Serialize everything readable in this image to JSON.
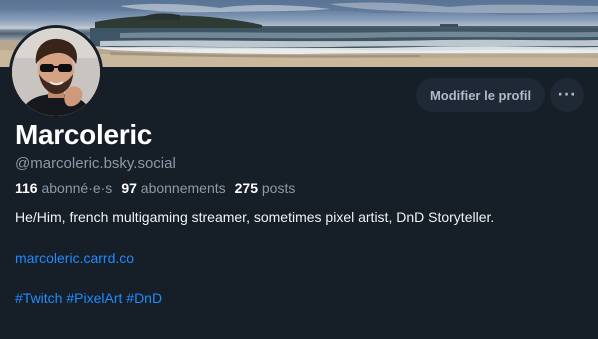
{
  "profile": {
    "display_name": "Marcoleric",
    "handle": "@marcoleric.bsky.social",
    "bio": "He/Him, french multigaming streamer, sometimes pixel artist, DnD Storyteller.",
    "link": "marcoleric.carrd.co",
    "hashtags": [
      "#Twitch",
      "#PixelArt",
      "#DnD"
    ]
  },
  "stats": {
    "followers_count": "116",
    "followers_label": "abonné·e·s",
    "following_count": "97",
    "following_label": "abonnements",
    "posts_count": "275",
    "posts_label": "posts"
  },
  "actions": {
    "edit_profile_label": "Modifier le profil",
    "more_icon": "more-horizontal-icon"
  },
  "colors": {
    "background": "#161e27",
    "button_bg": "#1e2935",
    "link": "#208bfe",
    "muted_text": "#8c99a8"
  }
}
